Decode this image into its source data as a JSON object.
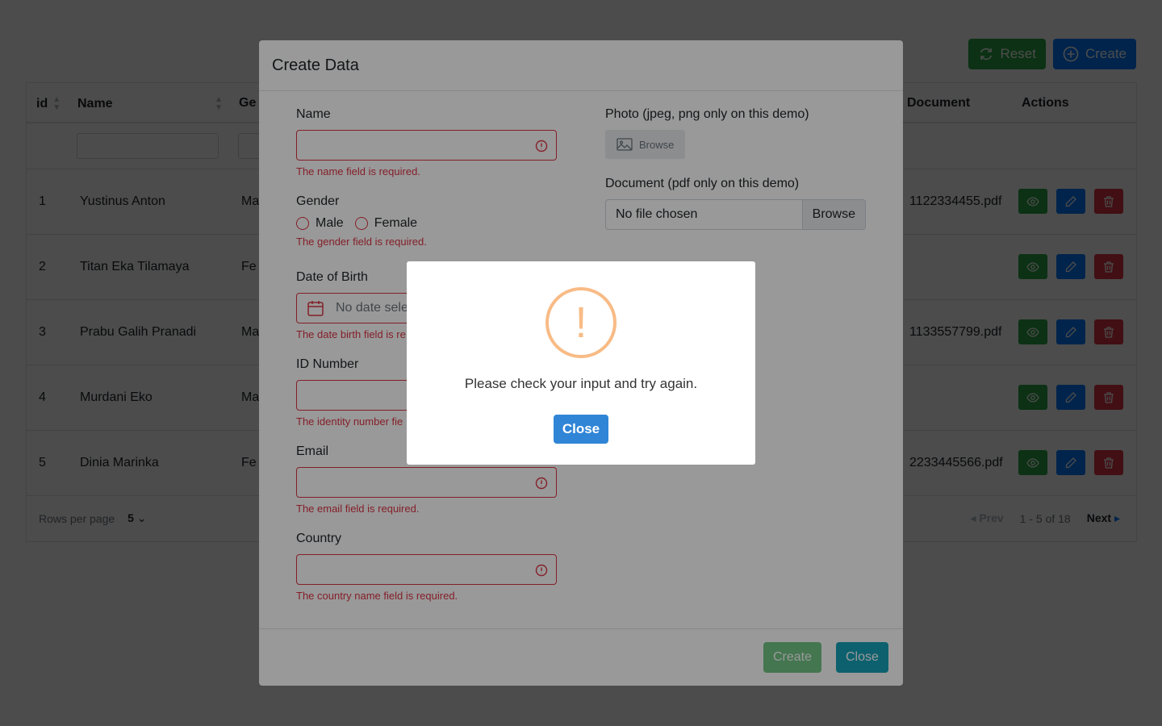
{
  "toolbar": {
    "reset_label": "Reset",
    "create_label": "Create"
  },
  "table": {
    "columns": [
      "id",
      "Name",
      "Ge",
      "Document",
      "Actions"
    ],
    "rows": [
      {
        "id": "1",
        "name": "Yustinus Anton",
        "gender": "Ma",
        "document": "1122334455.pdf"
      },
      {
        "id": "2",
        "name": "Titan Eka Tilamaya",
        "gender": "Fe",
        "document": ""
      },
      {
        "id": "3",
        "name": "Prabu Galih Pranadi",
        "gender": "Ma",
        "document": "1133557799.pdf"
      },
      {
        "id": "4",
        "name": "Murdani Eko",
        "gender": "Ma",
        "document": ""
      },
      {
        "id": "5",
        "name": "Dinia Marinka",
        "gender": "Fe",
        "document": "2233445566.pdf"
      }
    ],
    "footer": {
      "rows_per_page_label": "Rows per page",
      "rows_per_page_value": "5",
      "prev": "Prev",
      "range": "1 - 5 of 18",
      "next": "Next"
    }
  },
  "modal": {
    "title": "Create Data",
    "name": {
      "label": "Name",
      "value": "",
      "error": "The name field is required."
    },
    "gender": {
      "label": "Gender",
      "options": [
        "Male",
        "Female"
      ],
      "error": "The gender field is required."
    },
    "dob": {
      "label": "Date of Birth",
      "placeholder": "No date sele",
      "error": "The date birth field is re"
    },
    "id_number": {
      "label": "ID Number",
      "value": "",
      "error": "The identity number fie"
    },
    "email": {
      "label": "Email",
      "value": "",
      "error": "The email field is required."
    },
    "country": {
      "label": "Country",
      "value": "",
      "error": "The country name field is required."
    },
    "photo": {
      "label": "Photo (jpeg, png only on this demo)",
      "button": "Browse"
    },
    "document": {
      "label": "Document (pdf only on this demo)",
      "file_text": "No file chosen",
      "button": "Browse"
    },
    "footer": {
      "create_label": "Create",
      "close_label": "Close"
    }
  },
  "alert": {
    "icon_glyph": "!",
    "message": "Please check your input and try again.",
    "button": "Close"
  },
  "colors": {
    "green": "#28a745",
    "blue": "#007bff",
    "red": "#dc3545",
    "teal": "#17a2b8",
    "warning": "#f8bb86",
    "alert_button": "#3085d6"
  }
}
